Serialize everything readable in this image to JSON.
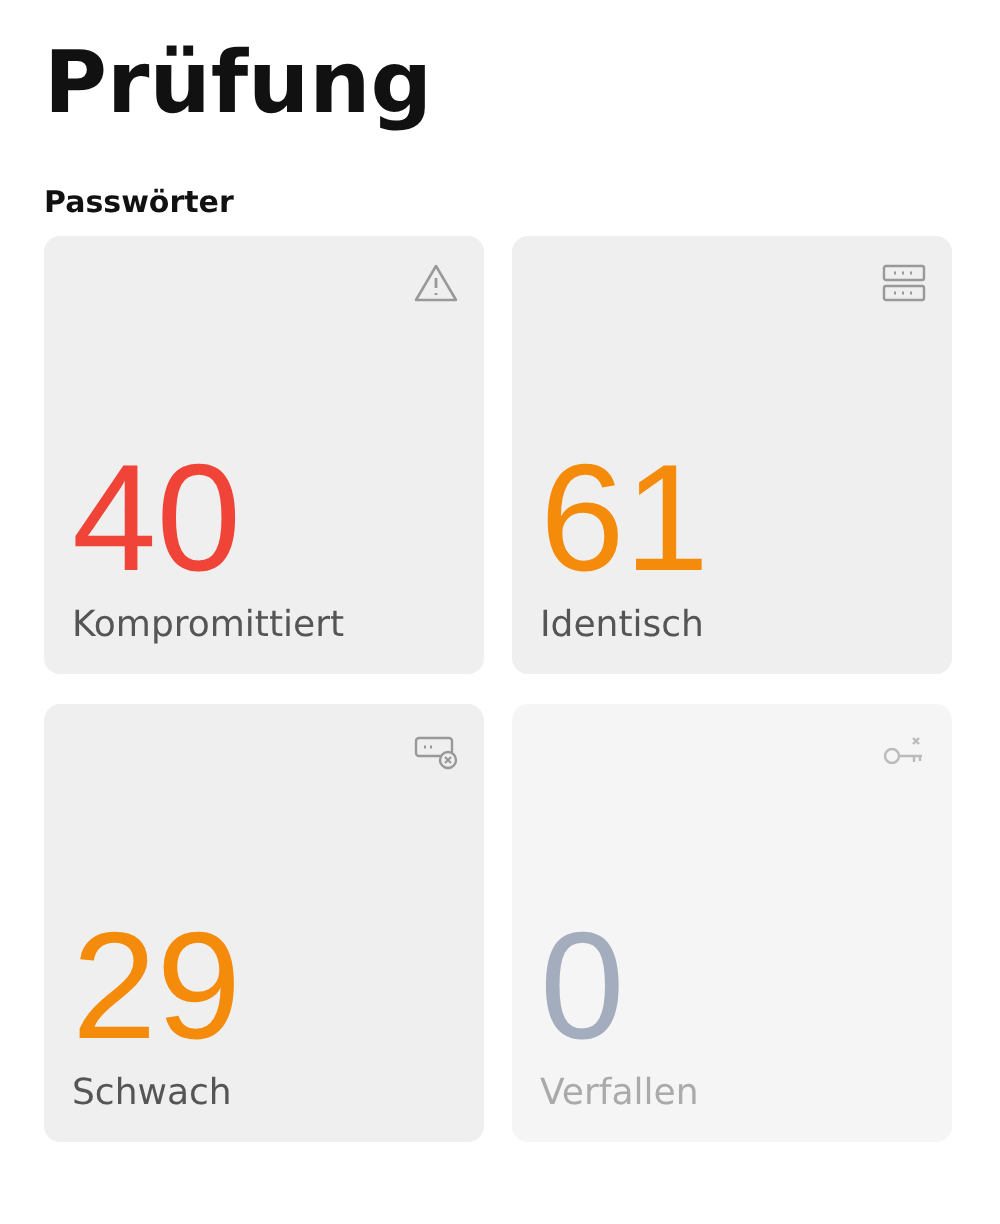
{
  "title": "Prüfung",
  "section": "Passwörter",
  "cards": [
    {
      "kind": "warning",
      "count": "40",
      "label": "Kompromittiert",
      "color": "#f04438",
      "disabled": false
    },
    {
      "kind": "duplicate",
      "count": "61",
      "label": "Identisch",
      "color": "#f58b0a",
      "disabled": false
    },
    {
      "kind": "weak",
      "count": "29",
      "label": "Schwach",
      "color": "#f58b0a",
      "disabled": false
    },
    {
      "kind": "expired",
      "count": "0",
      "label": "Verfallen",
      "color": "#a3adbd",
      "disabled": true
    }
  ]
}
